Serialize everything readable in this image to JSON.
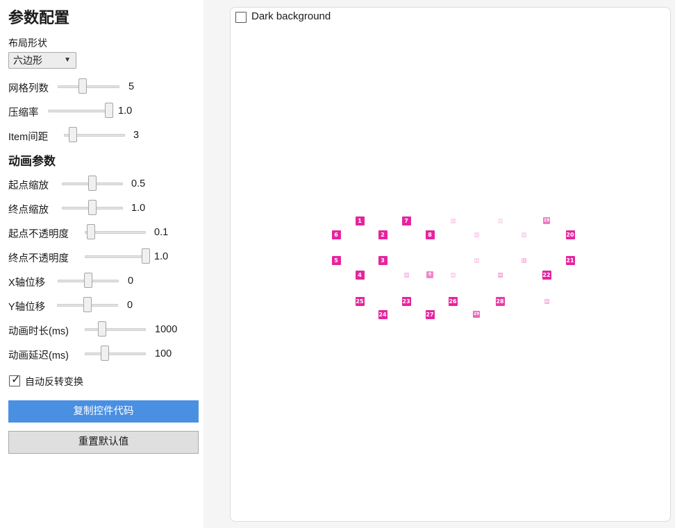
{
  "sidebar": {
    "title": "参数配置",
    "layout_shape_label": "布局形状",
    "layout_shape_value": "六边形",
    "grid_columns": {
      "label": "网格列数",
      "value": "5",
      "fraction": 0.4
    },
    "compression": {
      "label": "压缩率",
      "value": "1.0",
      "fraction": 1.0
    },
    "item_spacing": {
      "label": "Item间距",
      "value": "3",
      "fraction": 0.15
    },
    "animation_section_title": "动画参数",
    "start_scale": {
      "label": "起点缩放",
      "value": "0.5",
      "fraction": 0.5
    },
    "end_scale": {
      "label": "终点缩放",
      "value": "1.0",
      "fraction": 0.5
    },
    "start_opacity": {
      "label": "起点不透明度",
      "value": "0.1",
      "fraction": 0.1
    },
    "end_opacity": {
      "label": "终点不透明度",
      "value": "1.0",
      "fraction": 1.0
    },
    "x_offset": {
      "label": "X轴位移",
      "value": "0",
      "fraction": 0.5
    },
    "y_offset": {
      "label": "Y轴位移",
      "value": "0",
      "fraction": 0.5
    },
    "duration": {
      "label": "动画时长(ms)",
      "value": "1000",
      "fraction": 0.28
    },
    "delay": {
      "label": "动画延迟(ms)",
      "value": "100",
      "fraction": 0.33
    },
    "auto_reverse": {
      "label": "自动反转变换",
      "checked": true
    },
    "copy_button": "复制控件代码",
    "reset_button": "重置默认值"
  },
  "preview": {
    "dark_background_label": "Dark background",
    "dark_background_checked": false,
    "accent_color": "#e6249e",
    "cells": [
      {
        "n": "1",
        "size": "large",
        "opacity": 1.0
      },
      {
        "n": "7",
        "size": "large",
        "opacity": 1.0
      },
      {
        "n": "11",
        "size": "small",
        "opacity": 0.2
      },
      {
        "n": "15",
        "size": "small",
        "opacity": 0.15
      },
      {
        "n": "19",
        "size": "mid",
        "opacity": 0.6
      },
      {
        "n": "6",
        "size": "large",
        "opacity": 1.0
      },
      {
        "n": "2",
        "size": "large",
        "opacity": 1.0
      },
      {
        "n": "8",
        "size": "large",
        "opacity": 1.0
      },
      {
        "n": "12",
        "size": "small",
        "opacity": 0.2
      },
      {
        "n": "16",
        "size": "small",
        "opacity": 0.2
      },
      {
        "n": "20",
        "size": "large",
        "opacity": 1.0
      },
      {
        "n": "5",
        "size": "large",
        "opacity": 1.0
      },
      {
        "n": "3",
        "size": "large",
        "opacity": 1.0
      },
      {
        "n": "9",
        "size": "mid",
        "opacity": 0.55
      },
      {
        "n": "13",
        "size": "small",
        "opacity": 0.2
      },
      {
        "n": "17",
        "size": "small",
        "opacity": 0.3
      },
      {
        "n": "21",
        "size": "large",
        "opacity": 1.0
      },
      {
        "n": "4",
        "size": "large",
        "opacity": 1.0
      },
      {
        "n": "10",
        "size": "small",
        "opacity": 0.3
      },
      {
        "n": "14",
        "size": "small",
        "opacity": 0.2
      },
      {
        "n": "18",
        "size": "small",
        "opacity": 0.4
      },
      {
        "n": "22",
        "size": "large",
        "opacity": 1.0
      },
      {
        "n": "25",
        "size": "large",
        "opacity": 1.0
      },
      {
        "n": "23",
        "size": "large",
        "opacity": 1.0
      },
      {
        "n": "26",
        "size": "large",
        "opacity": 1.0
      },
      {
        "n": "28",
        "size": "large",
        "opacity": 0.9
      },
      {
        "n": "30",
        "size": "small",
        "opacity": 0.35
      },
      {
        "n": "24",
        "size": "large",
        "opacity": 1.0
      },
      {
        "n": "27",
        "size": "large",
        "opacity": 1.0
      },
      {
        "n": "29",
        "size": "mid",
        "opacity": 0.7
      }
    ]
  }
}
